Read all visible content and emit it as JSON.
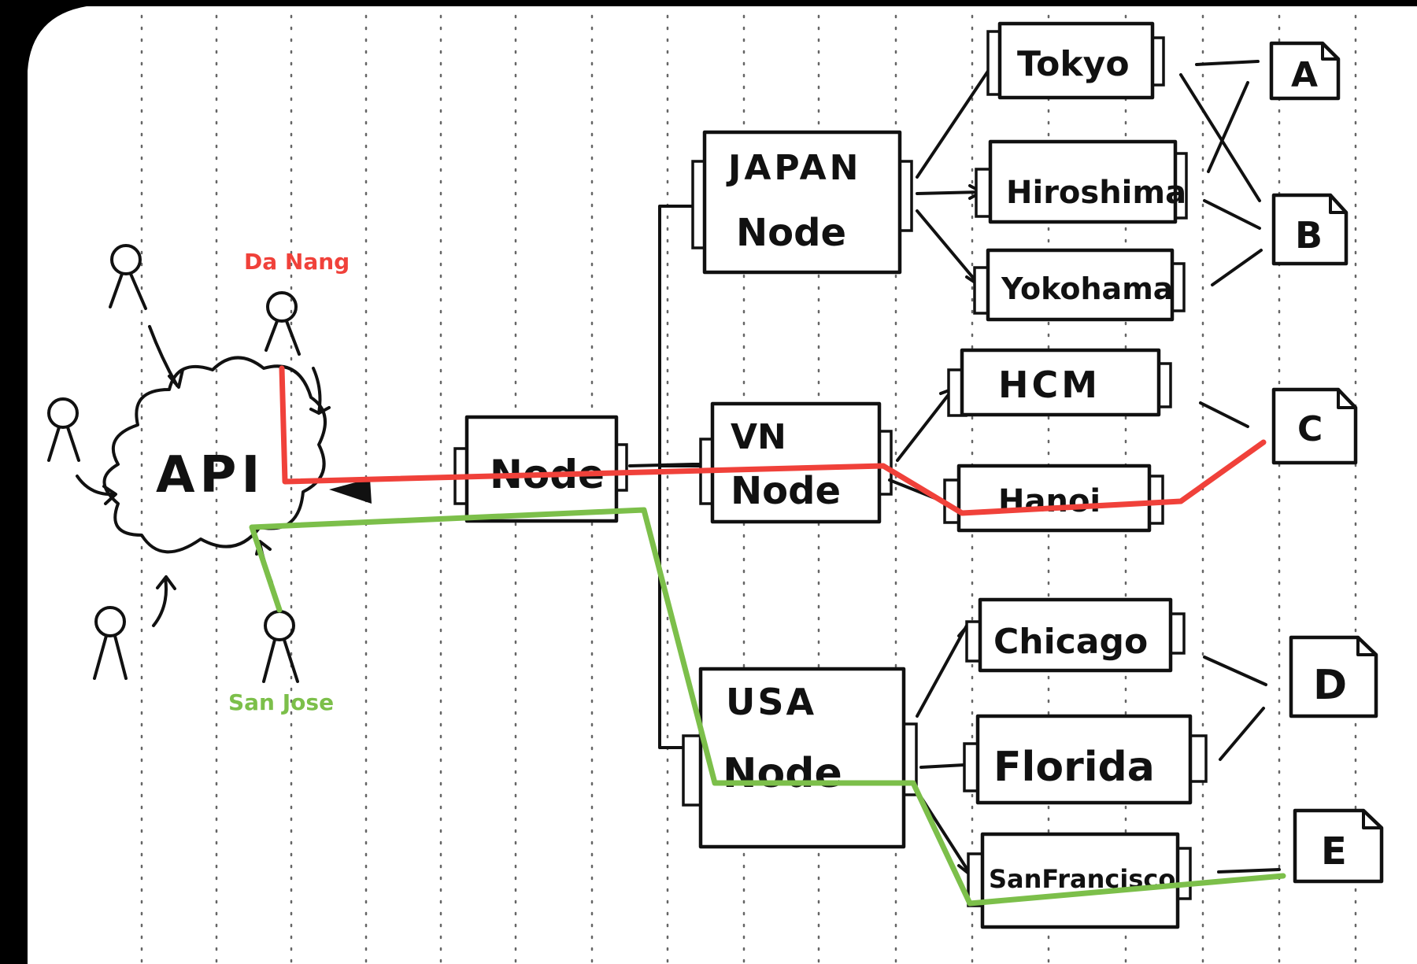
{
  "colors": {
    "paper": "#ffffff",
    "ink": "#111111",
    "route_red": "#f0413a",
    "route_green": "#7cbf4a",
    "dots": "#555555"
  },
  "cloud": {
    "label": "API"
  },
  "main_node": {
    "label": "Node"
  },
  "regions": [
    {
      "id": "japan",
      "line1": "JAPAN",
      "line2": "Node"
    },
    {
      "id": "vn",
      "line1": "VN",
      "line2": "Node"
    },
    {
      "id": "usa",
      "line1": "USA",
      "line2": "Node"
    }
  ],
  "cities": [
    {
      "id": "tokyo",
      "label": "Tokyo"
    },
    {
      "id": "hiroshima",
      "label": "Hiroshima"
    },
    {
      "id": "yokohama",
      "label": "Yokohama"
    },
    {
      "id": "hcm",
      "label": "HCM"
    },
    {
      "id": "hanoi",
      "label": "Hanoi"
    },
    {
      "id": "chicago",
      "label": "Chicago"
    },
    {
      "id": "florida",
      "label": "Florida"
    },
    {
      "id": "sanfrancisco",
      "label": "SanFrancisco"
    }
  ],
  "documents": [
    "A",
    "B",
    "C",
    "D",
    "E"
  ],
  "user_labels": {
    "da_nang": "Da Nang",
    "san_jose": "San Jose"
  }
}
